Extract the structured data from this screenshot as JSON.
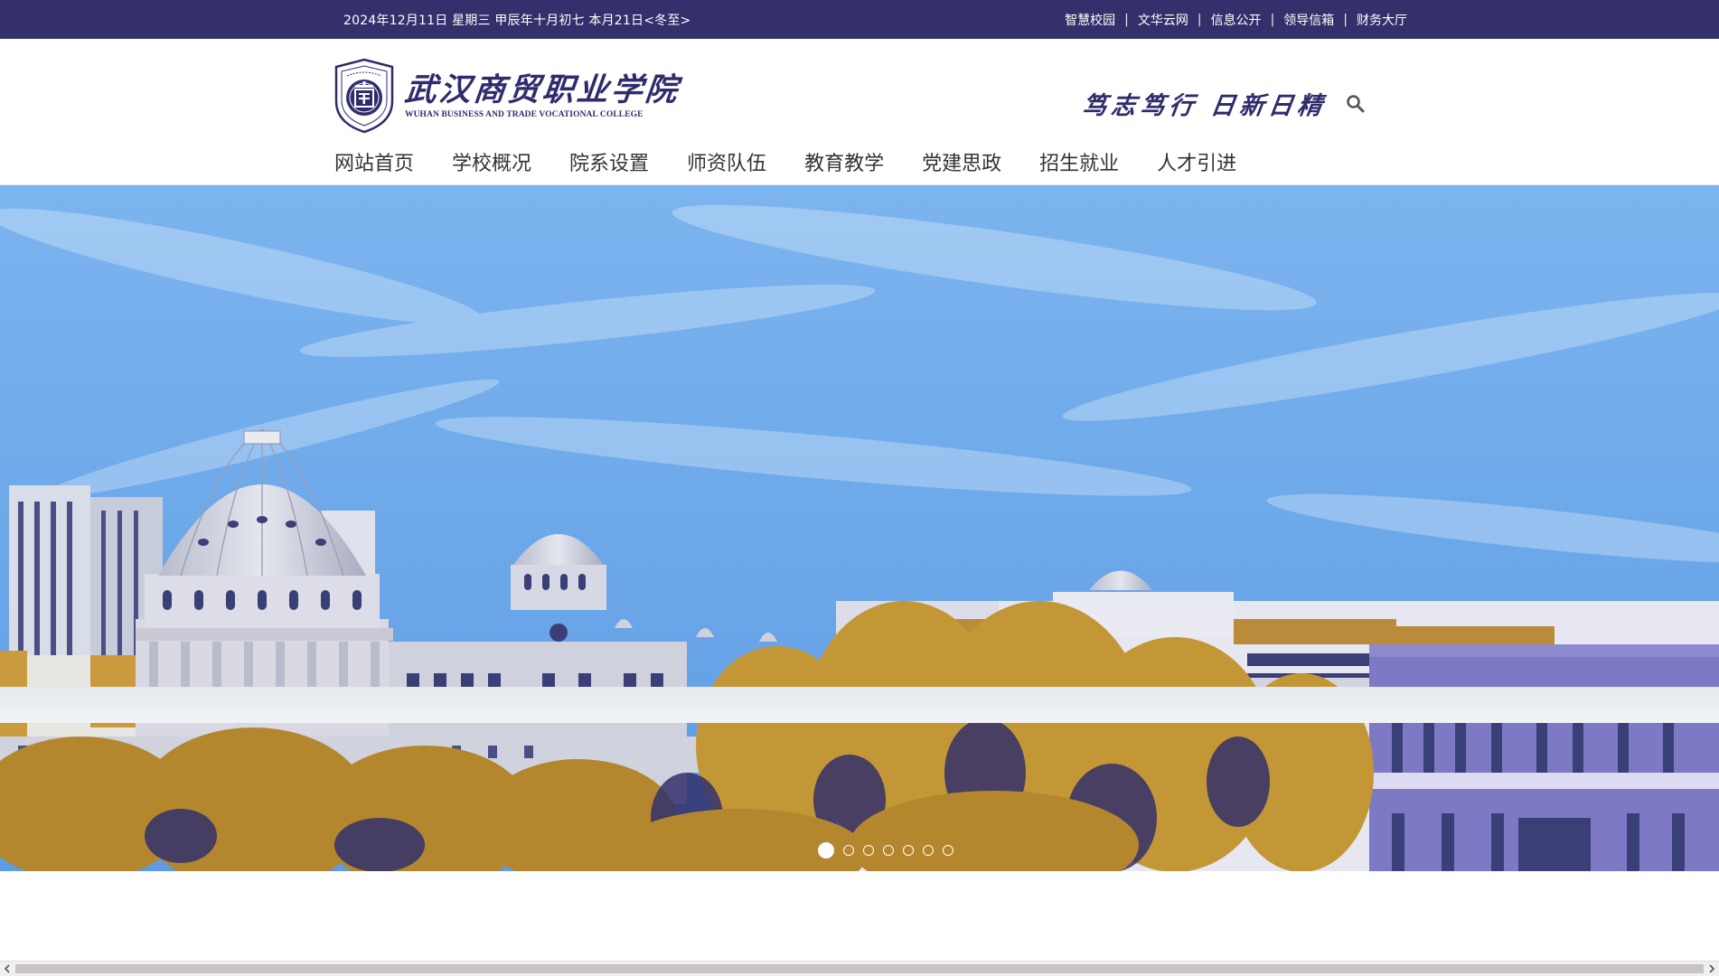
{
  "topbar": {
    "date_text": "2024年12月11日  星期三  甲辰年十月初七  本月21日<冬至>",
    "links": [
      "智慧校园",
      "文华云网",
      "信息公开",
      "领导信箱",
      "财务大厅"
    ],
    "separator": "|"
  },
  "header": {
    "logo_cn": "武汉商贸职业学院",
    "logo_en": "WUHAN BUSINESS AND TRADE VOCATIONAL COLLEGE",
    "motto_left": "笃志笃行",
    "motto_right": "日新日精"
  },
  "nav": {
    "items": [
      "网站首页",
      "学校概况",
      "院系设置",
      "师资队伍",
      "教育教学",
      "党建思政",
      "招生就业",
      "人才引进"
    ]
  },
  "banner": {
    "slide_count": 7,
    "active_slide": 1,
    "image_icon": "campus-dome-building-photo"
  },
  "colors": {
    "brand": "#33306b",
    "sky": "#6aa6e8",
    "foliage": "#b4862e"
  }
}
